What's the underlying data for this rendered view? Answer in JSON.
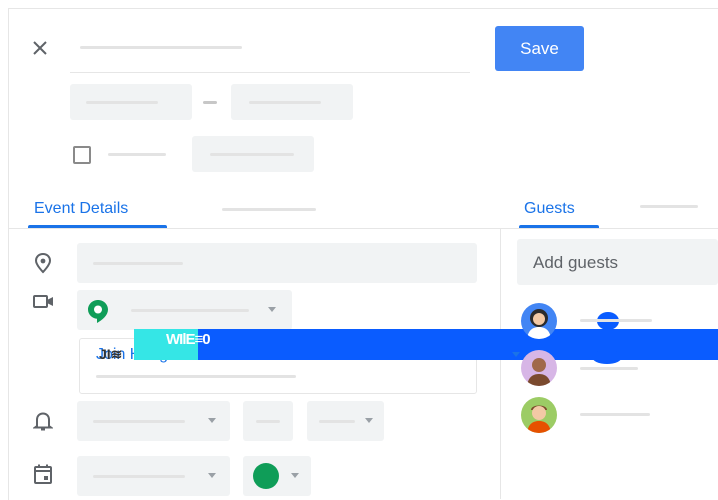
{
  "toolbar": {
    "save_label": "Save"
  },
  "tabs": {
    "event_details": "Event Details",
    "guests": "Guests"
  },
  "guests": {
    "add_placeholder": "Add guests"
  },
  "conferencing": {
    "meet_text": "Join Hangouts Meet",
    "overlay_text": "WIlE≡0",
    "glitch_prefix": "JI≋"
  },
  "colors": {
    "accent": "#1a73e8",
    "save": "#4285f4",
    "event_color": "#0f9d58"
  },
  "icons": [
    "close-icon",
    "location-pin-icon",
    "video-icon",
    "hangouts-icon",
    "bell-icon",
    "calendar-icon"
  ]
}
